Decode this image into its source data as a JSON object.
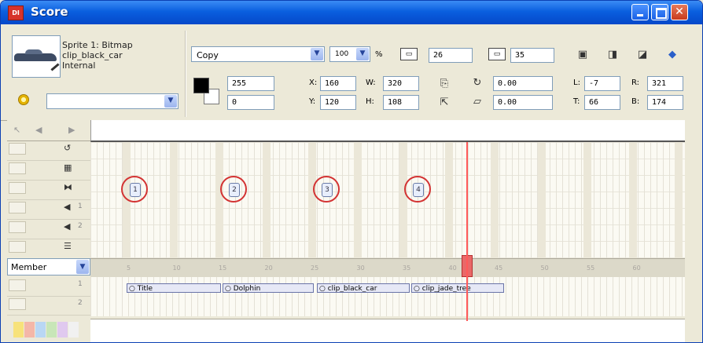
{
  "window": {
    "title": "Score",
    "app_icon_text": "DI"
  },
  "sprite_info": {
    "line1": "Sprite 1: Bitmap",
    "line2": "clip_black_car",
    "line3": "Internal"
  },
  "ink": {
    "value": "Copy"
  },
  "blend": {
    "value": "100",
    "suffix": "%"
  },
  "start_frame": "26",
  "end_frame": "35",
  "fore_color_value": "255",
  "back_color_value": "0",
  "position": {
    "x_label": "X:",
    "x": "160",
    "y_label": "Y:",
    "y": "120"
  },
  "size": {
    "w_label": "W:",
    "w": "320",
    "h_label": "H:",
    "h": "108"
  },
  "rotation": "0.00",
  "skew": "0.00",
  "bounds": {
    "l_label": "L:",
    "l": "-7",
    "t_label": "T:",
    "t": "66",
    "r_label": "R:",
    "r": "321",
    "b_label": "B:",
    "b": "174"
  },
  "member_selector": {
    "value": "Member"
  },
  "channel_icons": [
    "tempo-icon",
    "palette-icon",
    "transition-icon",
    "sound1-icon",
    "sound2-icon",
    "script-icon"
  ],
  "channel_labels": [
    "",
    "",
    "",
    "1",
    "2",
    ""
  ],
  "sprite_channel_numbers": [
    "1",
    "2"
  ],
  "frame_ruler": [
    "5",
    "10",
    "15",
    "20",
    "25",
    "30",
    "35",
    "40",
    "45",
    "50",
    "55",
    "60"
  ],
  "markers": [
    "1",
    "2",
    "3",
    "4"
  ],
  "sprites": [
    {
      "label": "Title"
    },
    {
      "label": "Dolphin"
    },
    {
      "label": "clip_black_car"
    },
    {
      "label": "clip_jade_tree"
    }
  ],
  "colors": {
    "titlebar": "#0a5fdf",
    "marker": "#d33333",
    "playhead": "#ff5a5a"
  }
}
